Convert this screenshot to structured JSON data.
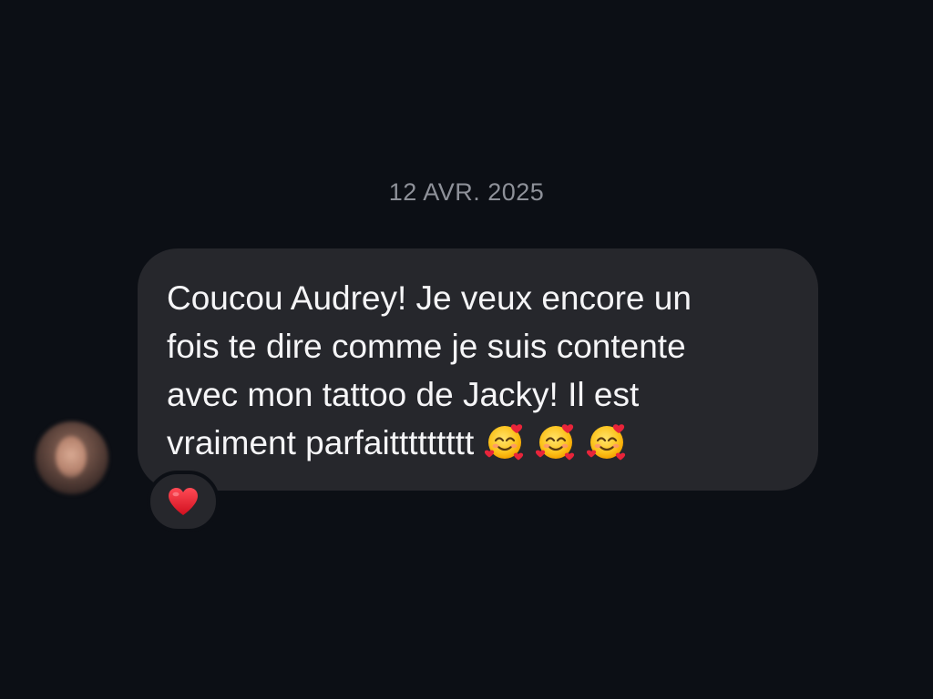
{
  "conversation": {
    "date_separator": "12 AVR. 2025",
    "message": {
      "text": "Coucou Audrey! Je veux encore un\nfois te dire comme je suis contente\navec mon tattoo de Jacky! Il est\nvraiment parfaittttttttt",
      "emojis": [
        "smiling-face-with-hearts-icon",
        "smiling-face-with-hearts-icon",
        "smiling-face-with-hearts-icon"
      ],
      "reaction": "red-heart-icon"
    },
    "colors": {
      "background": "#0c0f15",
      "bubble": "#26272c",
      "text": "#f5f5f7",
      "date": "#8e9199",
      "heart": "#e0202f"
    }
  }
}
